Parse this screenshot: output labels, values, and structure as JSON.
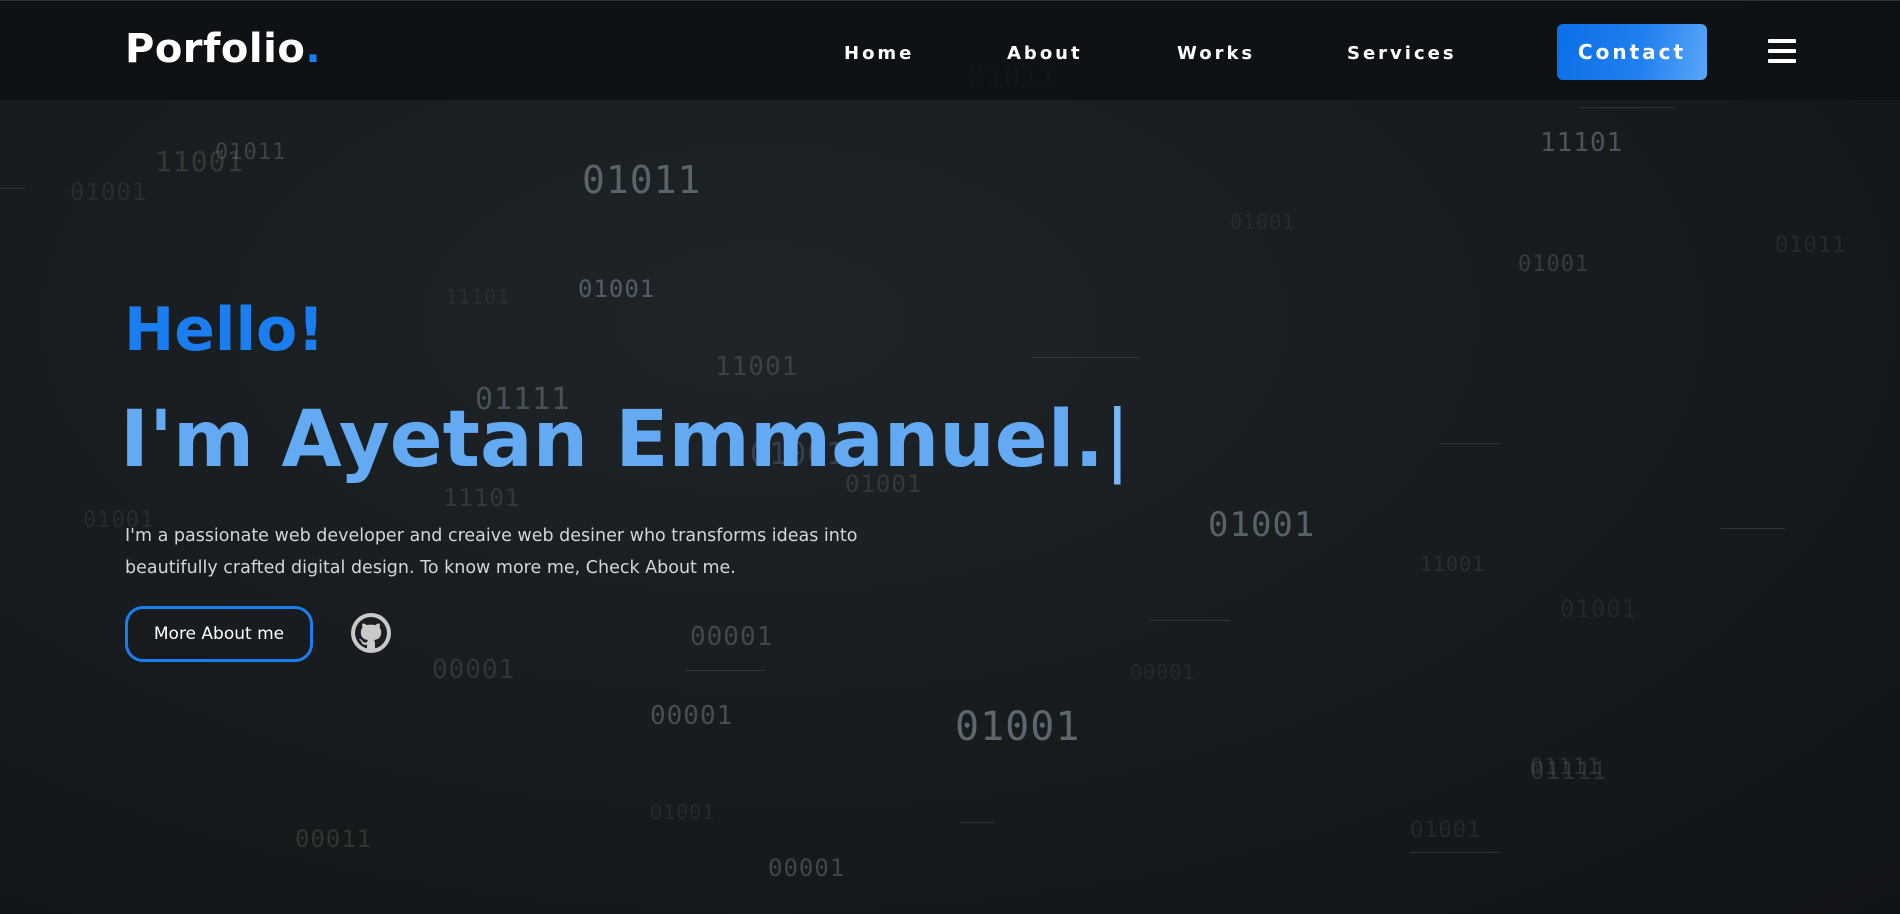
{
  "brand": {
    "name": "Porfolio",
    "dot": "."
  },
  "nav": {
    "links": [
      "Home",
      "About",
      "Works",
      "Services"
    ],
    "contact_label": "Contact",
    "menu_icon": "hamburger-menu-icon"
  },
  "hero": {
    "greeting": "Hello!",
    "headline": "I'm Ayetan Emmanuel.",
    "cursor": "|",
    "intro_line1": "I'm a passionate web developer and creaive web desiner who transforms ideas into",
    "intro_line2": "beautifully crafted digital design. To know more me, Check About me.",
    "more_button": "More About me",
    "github_icon": "github-icon"
  },
  "background": {
    "binary_strings": [
      "01011",
      "01001",
      "11001",
      "01111",
      "01001",
      "00001",
      "01001",
      "11101",
      "01001",
      "00001",
      "11001",
      "01011",
      "11101",
      "00001",
      "01111",
      "00001",
      "00011",
      "01001",
      "01011",
      "01001",
      "11001",
      "01001",
      "01001",
      "01111",
      "01001",
      "01011",
      "01001",
      "01001",
      "00001",
      "11101",
      "01001"
    ]
  },
  "colors": {
    "accent": "#1a7ef0",
    "headline": "#64aaf3",
    "background": "#1a1f22",
    "navbar": "#0e1113",
    "text_muted": "#cfd6dc"
  }
}
